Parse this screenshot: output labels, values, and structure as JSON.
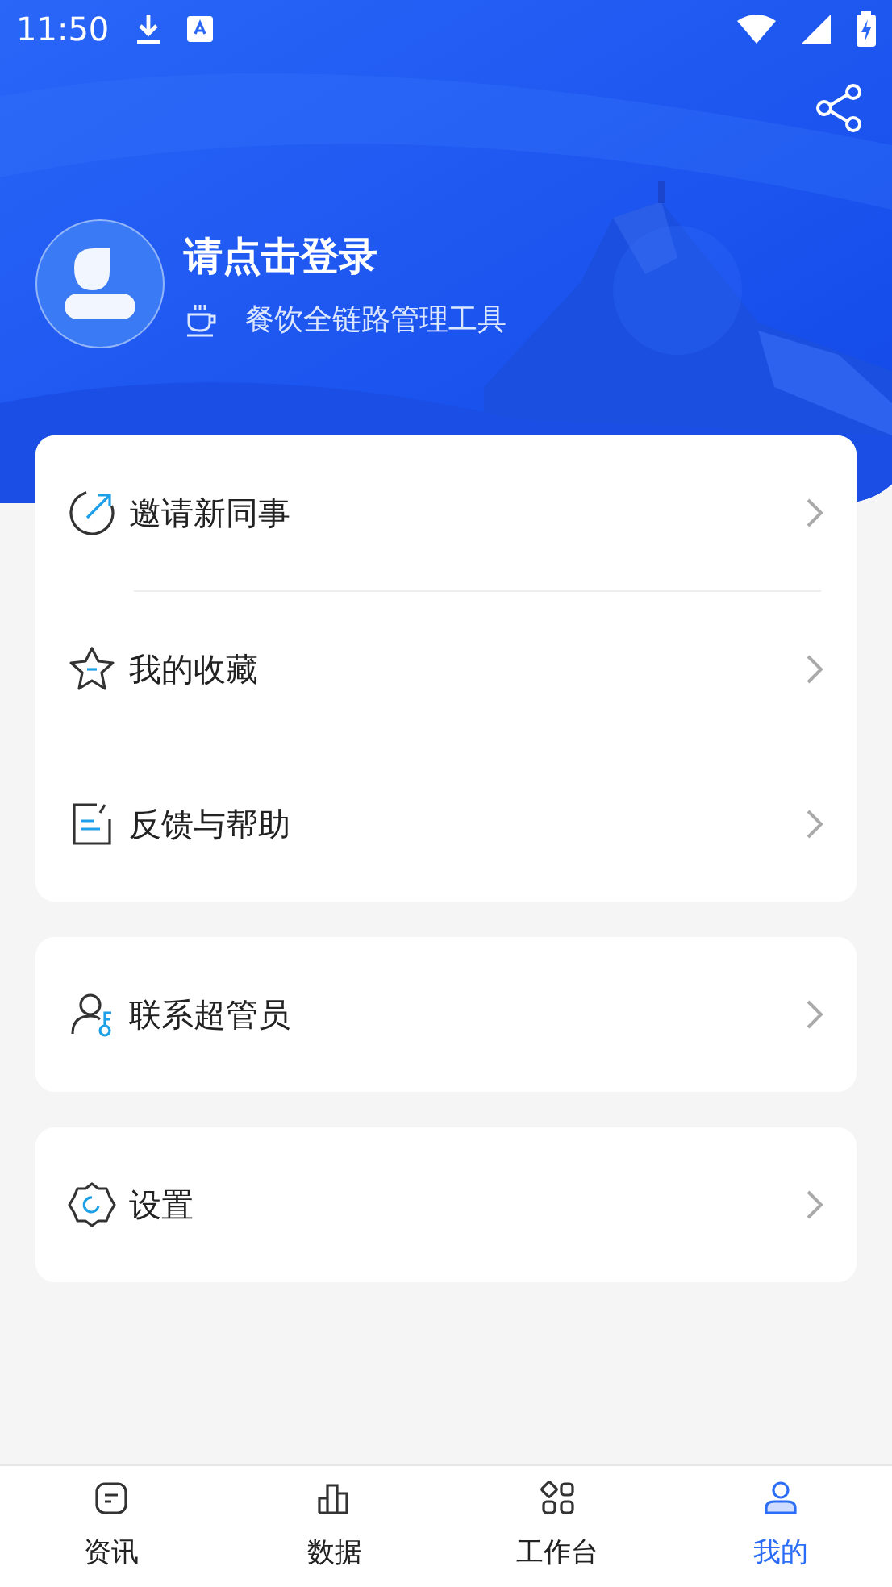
{
  "status_bar": {
    "time": "11:50"
  },
  "profile": {
    "title": "请点击登录",
    "subtitle": "餐饮全链路管理工具"
  },
  "menu_groups": [
    {
      "items": [
        {
          "label": "邀请新同事",
          "divider_below": true
        },
        {
          "label": "我的收藏",
          "divider_below": false
        },
        {
          "label": "反馈与帮助",
          "divider_below": false
        }
      ]
    },
    {
      "items": [
        {
          "label": "联系超管员",
          "divider_below": false
        }
      ]
    },
    {
      "items": [
        {
          "label": "设置",
          "divider_below": false
        }
      ]
    }
  ],
  "tab_bar": [
    {
      "label": "资讯",
      "selected": false
    },
    {
      "label": "数据",
      "selected": false
    },
    {
      "label": "工作台",
      "selected": false
    },
    {
      "label": "我的",
      "selected": true
    }
  ]
}
